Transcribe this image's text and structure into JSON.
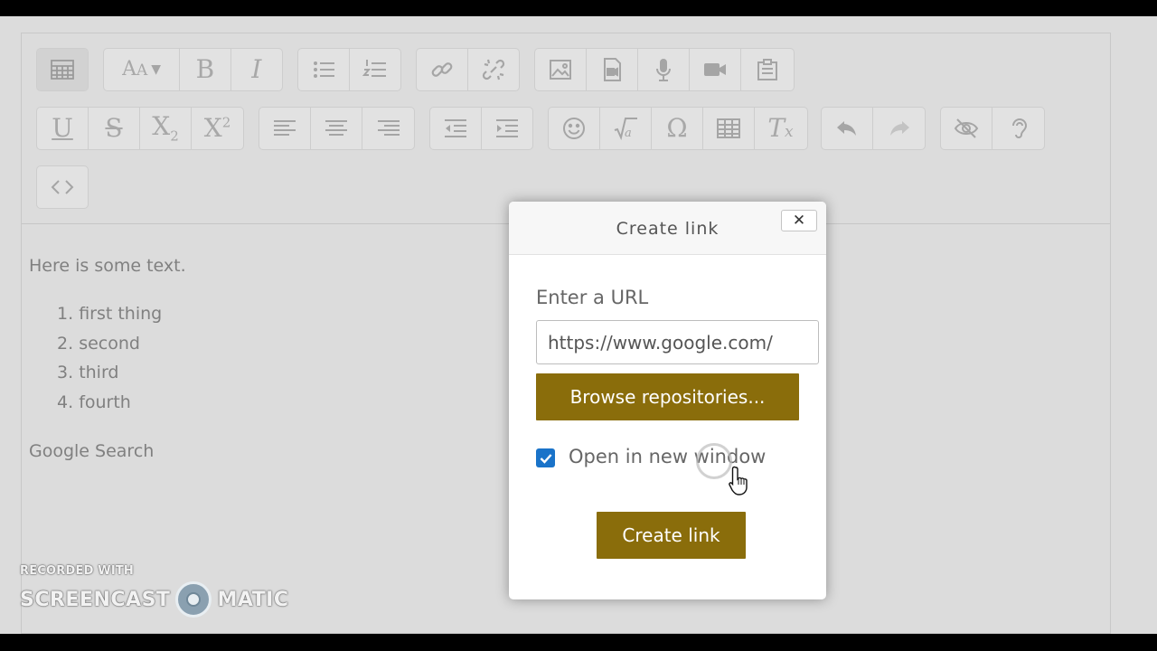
{
  "editor": {
    "toolbar_row1": [
      "collapse-icon",
      "font-size-icon",
      "bold-icon",
      "italic-icon",
      "bullet-list-icon",
      "numbered-list-icon",
      "link-icon",
      "unlink-icon",
      "image-icon",
      "media-icon",
      "record-audio-icon",
      "record-video-icon",
      "manage-files-icon"
    ],
    "toolbar_row2": [
      "underline-icon",
      "strikethrough-icon",
      "subscript-icon",
      "superscript-icon",
      "align-left-icon",
      "align-center-icon",
      "align-right-icon",
      "outdent-icon",
      "indent-icon",
      "emoticon-icon",
      "equation-icon",
      "special-character-icon",
      "table-icon",
      "clear-formatting-icon",
      "undo-icon",
      "redo-icon",
      "accessibility-checker-icon",
      "screenreader-helper-icon"
    ],
    "toolbar_row3": [
      "html-icon"
    ],
    "content": {
      "paragraph": "Here is some text.",
      "list": [
        {
          "num": "1.",
          "text": "first thing"
        },
        {
          "num": "2.",
          "text": "second"
        },
        {
          "num": "3.",
          "text": "third"
        },
        {
          "num": "4.",
          "text": "fourth"
        }
      ],
      "link_text": "Google Search"
    }
  },
  "dialog": {
    "title": "Create link",
    "close_glyph": "✕",
    "url_label": "Enter a URL",
    "url_value": "https://www.google.com/",
    "browse_label": "Browse repositories...",
    "checkbox_label": "Open in new window",
    "checkbox_checked": true,
    "create_label": "Create link",
    "accent_color": "#8a6d0b",
    "checkbox_color": "#1a73c9"
  },
  "watermark": {
    "top": "RECORDED WITH",
    "left": "SCREENCAST",
    "right": "MATIC"
  }
}
